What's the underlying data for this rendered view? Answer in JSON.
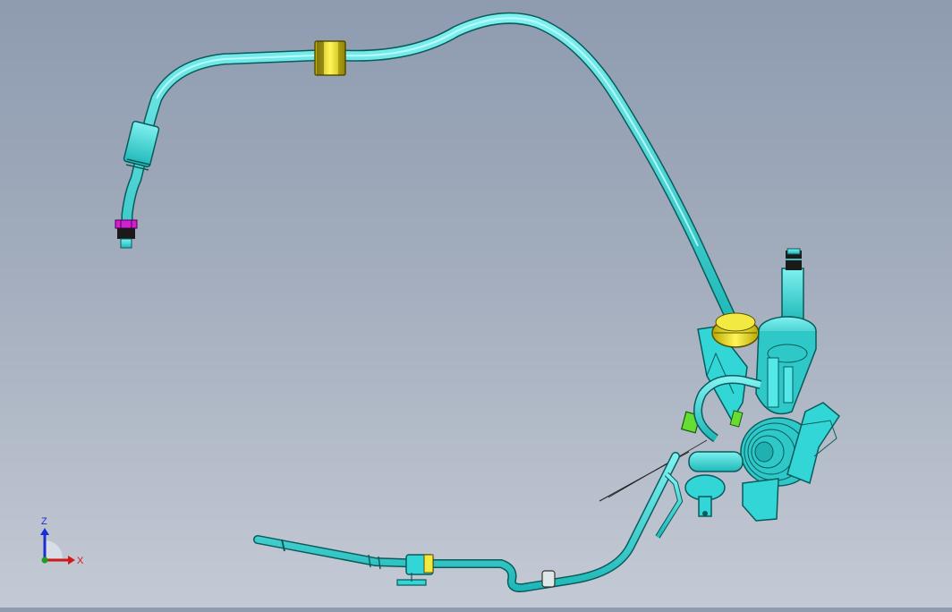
{
  "viewport": {
    "background_top": "#8e9bb0",
    "background_bottom": "#c4cad5"
  },
  "model": {
    "tube_color": "#33d6d6",
    "tube_outline": "#0a5a5a",
    "clamp_color": "#e8e22a",
    "nut_color": "#d020d0",
    "clip_color": "#66dd33"
  },
  "triad": {
    "z_label": "Z",
    "x_label": "X",
    "z_color": "#1a2fd0",
    "x_color": "#d01a1a",
    "y_color": "#1aa01a"
  }
}
